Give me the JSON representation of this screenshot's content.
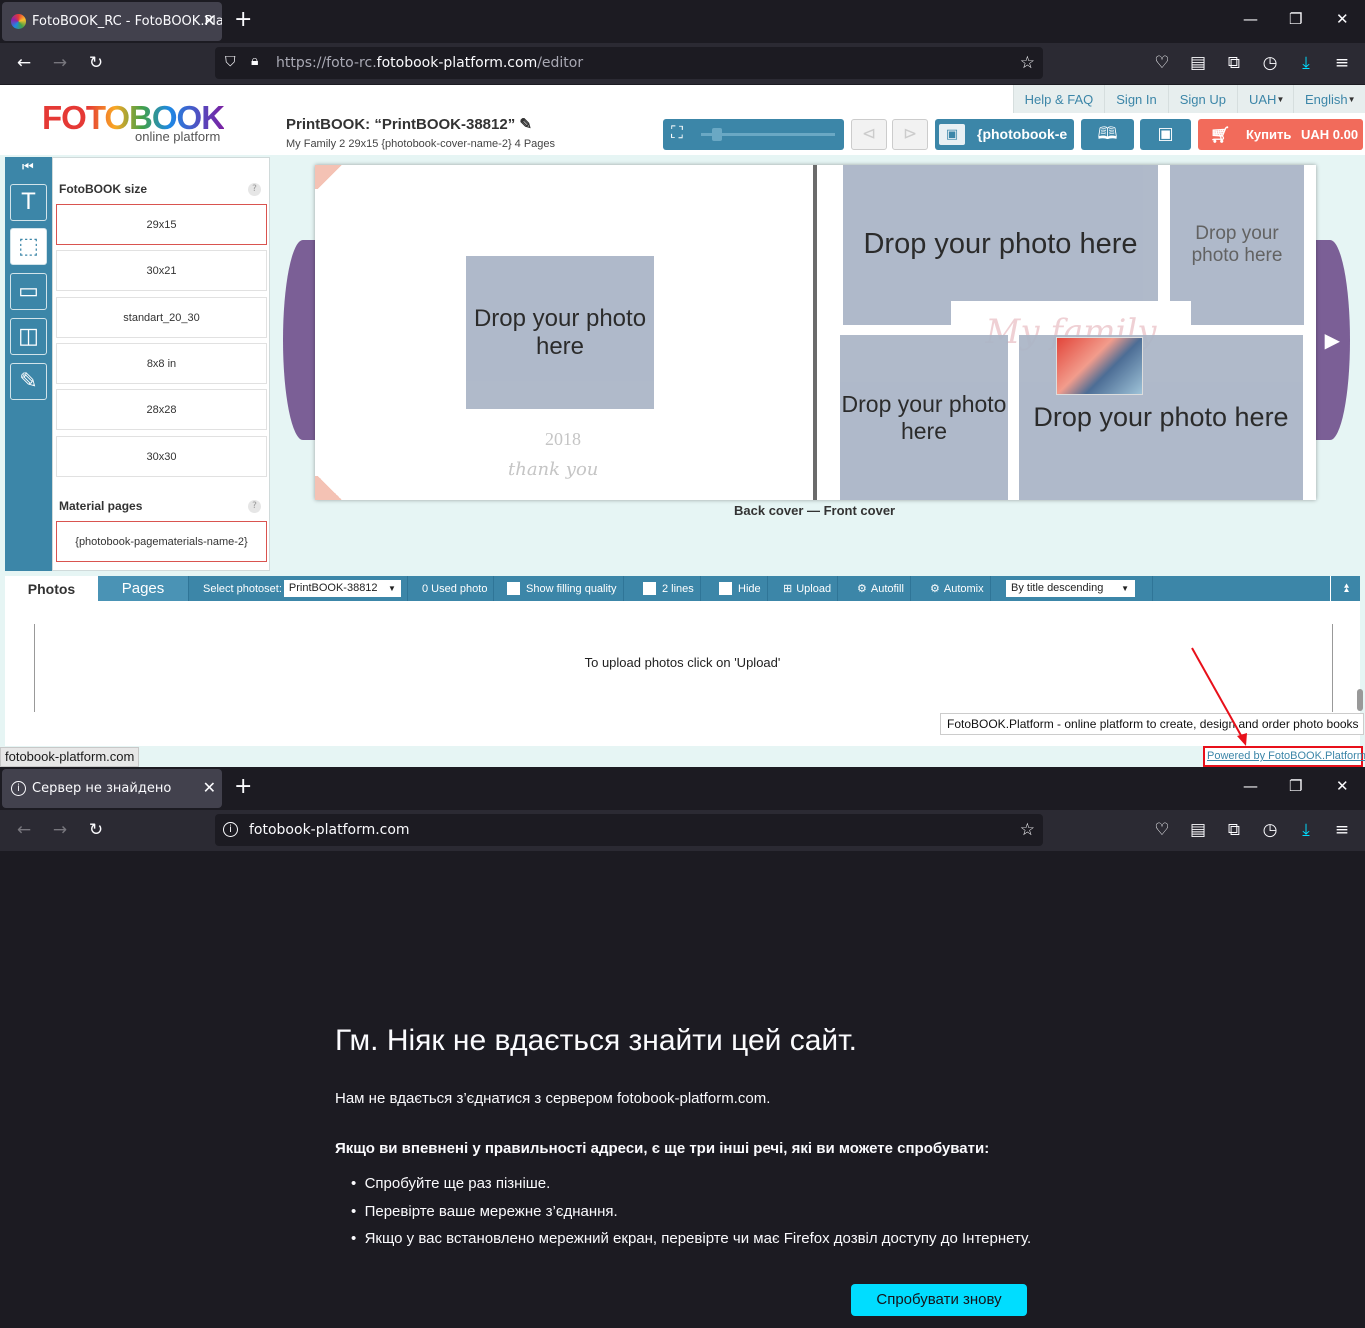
{
  "top_browser": {
    "tab_title": "FotoBOOK_RC - FotoBOOK.Platf",
    "url_prefix": "https://foto-rc.",
    "url_domain": "fotobook-platform.com",
    "url_path": "/editor"
  },
  "editor": {
    "logo_main": "FOTOBOOK",
    "logo_sub": "online platform",
    "top_links": [
      "Help & FAQ",
      "Sign In",
      "Sign Up",
      "UAH",
      "English"
    ],
    "title": "PrintBOOK: “PrintBOOK-38812”",
    "subtitle": "My Family 2 29x15 {photobook-cover-name-2} 4 Pages",
    "cover_button": "{photobook-e",
    "buy_label": "Купить",
    "buy_price": "UAH 0.00",
    "size_heading": "FotoBOOK size",
    "sizes": [
      "29x15",
      "30x21",
      "standart_20_30",
      "8x8 in",
      "28x28",
      "30x30"
    ],
    "material_heading": "Material pages",
    "material_option": "{photobook-pagematerials-name-2}",
    "help_mark": "?",
    "drop_text": "Drop your photo here",
    "year_text": "2018",
    "thanks_text": "thank you",
    "family_text": "My family",
    "spread_caption": "Back cover — Front cover",
    "tabs": [
      "Photos",
      "Pages"
    ],
    "toolbar": {
      "select_label": "Select photoset:",
      "photoset": "PrintBOOK-38812",
      "used": "0 Used photo",
      "show_quality": "Show filling quality",
      "two_lines": "2 lines",
      "hide": "Hide",
      "upload": "Upload",
      "autofill": "Autofill",
      "automix": "Automix",
      "sort": "By title descending"
    },
    "upload_hint": "To upload photos click on 'Upload'",
    "tooltip": "FotoBOOK.Platform - online platform to create, design and order photo books",
    "powered": "Powered by FotoBOOK.Platform",
    "status_url": "fotobook-platform.com"
  },
  "bottom_browser": {
    "tab_title": "Сервер не знайдено",
    "url": "fotobook-platform.com"
  },
  "error_page": {
    "heading": "Гм. Ніяк не вдається знайти цей сайт.",
    "message": "Нам не вдається з’єднатися з сервером fotobook-platform.com.",
    "bold_line": "Якщо ви впевнені у правильності адреси, є ще три інші речі, які ви можете спробувати:",
    "items": [
      "Спробуйте ще раз пізніше.",
      "Перевірте ваше мережне з’єднання.",
      "Якщо у вас встановлено мережний екран, перевірте чи має Firefox дозвіл доступу до Інтернету."
    ],
    "retry": "Спробувати знову"
  },
  "colors": {
    "accent_blue": "#3c86a8",
    "buy_red": "#f26b5b",
    "retry_cyan": "#00ddff",
    "highlight_red": "#e8101a"
  }
}
